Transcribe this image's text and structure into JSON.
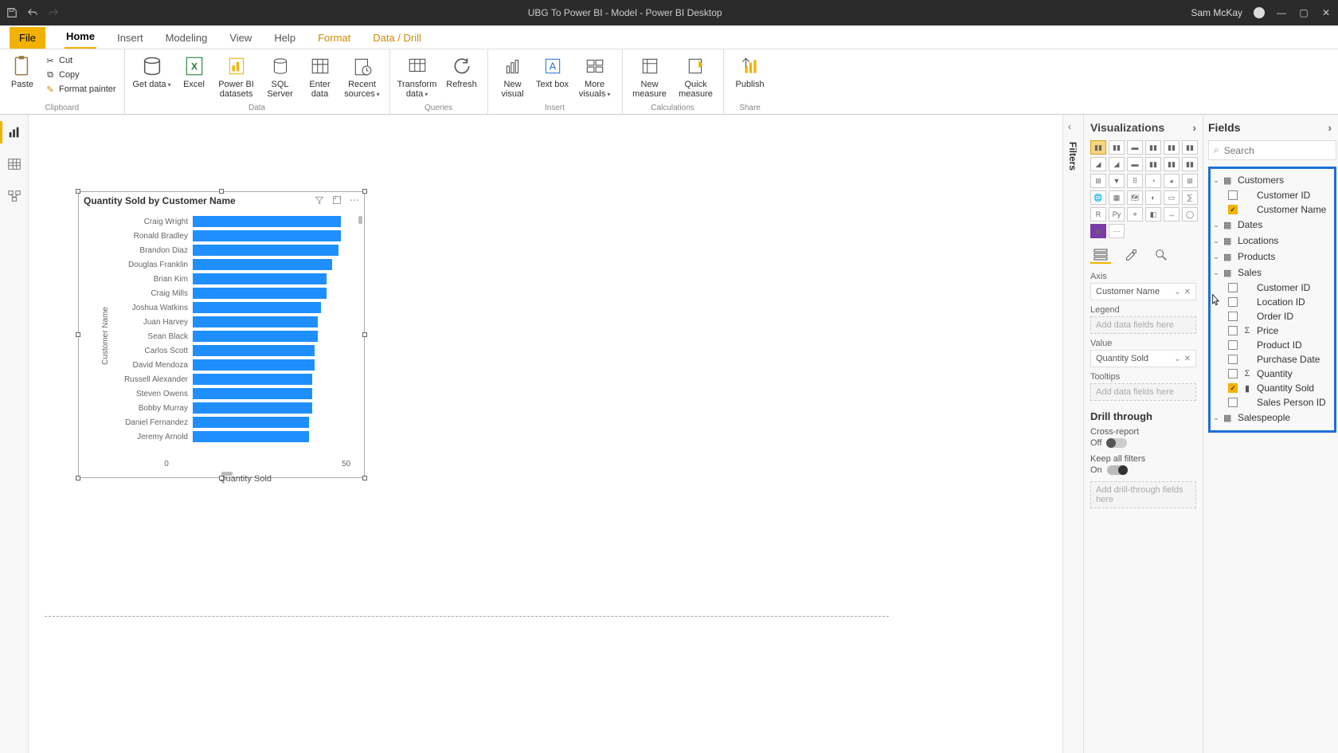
{
  "title_bar": {
    "title": "UBG To Power BI - Model - Power BI Desktop",
    "user": "Sam McKay"
  },
  "ribbon": {
    "tabs": [
      "File",
      "Home",
      "Insert",
      "Modeling",
      "View",
      "Help",
      "Format",
      "Data / Drill"
    ],
    "clipboard": {
      "label": "Clipboard",
      "paste": "Paste",
      "cut": "Cut",
      "copy": "Copy",
      "format_painter": "Format painter"
    },
    "data": {
      "label": "Data",
      "get_data": "Get data",
      "pbi_datasets": "Power BI datasets",
      "sql": "SQL Server",
      "excel": "Excel",
      "enter": "Enter data",
      "recent": "Recent sources"
    },
    "queries": {
      "label": "Queries",
      "transform": "Transform data",
      "refresh": "Refresh"
    },
    "insert": {
      "label": "Insert",
      "new_visual": "New visual",
      "text_box": "Text box",
      "more": "More visuals"
    },
    "calculations": {
      "label": "Calculations",
      "new_measure": "New measure",
      "quick": "Quick measure"
    },
    "share": {
      "label": "Share",
      "publish": "Publish"
    }
  },
  "visual": {
    "title": "Quantity Sold by Customer Name",
    "y_title": "Customer Name",
    "x_title": "Quantity Sold",
    "x_ticks": {
      "t0": "0",
      "t50": "50"
    }
  },
  "chart_data": {
    "type": "bar",
    "orientation": "horizontal",
    "title": "Quantity Sold by Customer Name",
    "xlabel": "Quantity Sold",
    "ylabel": "Customer Name",
    "xlim": [
      0,
      55
    ],
    "categories": [
      "Craig Wright",
      "Ronald Bradley",
      "Brandon Diaz",
      "Douglas Franklin",
      "Brian Kim",
      "Craig Mills",
      "Joshua Watkins",
      "Juan Harvey",
      "Sean Black",
      "Carlos Scott",
      "David Mendoza",
      "Russell Alexander",
      "Steven Owens",
      "Bobby Murray",
      "Daniel Fernandez",
      "Jeremy Arnold"
    ],
    "values": [
      51,
      51,
      50,
      48,
      46,
      46,
      44,
      43,
      43,
      42,
      42,
      41,
      41,
      41,
      40,
      40
    ]
  },
  "filters_pane": {
    "title": "Filters"
  },
  "viz_pane": {
    "title": "Visualizations",
    "wells": {
      "axis_label": "Axis",
      "axis_value": "Customer Name",
      "legend_label": "Legend",
      "legend_placeholder": "Add data fields here",
      "value_label": "Value",
      "value_value": "Quantity Sold",
      "tooltips_label": "Tooltips",
      "tooltips_placeholder": "Add data fields here"
    },
    "drill": {
      "title": "Drill through",
      "cross_report": "Cross-report",
      "cross_report_state": "Off",
      "keep_filters": "Keep all filters",
      "keep_filters_state": "On",
      "placeholder": "Add drill-through fields here"
    }
  },
  "fields_pane": {
    "title": "Fields",
    "search_placeholder": "Search",
    "tables": {
      "customers": {
        "name": "Customers",
        "fields": {
          "customer_id": "Customer ID",
          "customer_name": "Customer Name"
        }
      },
      "dates": "Dates",
      "locations": "Locations",
      "products": "Products",
      "sales": {
        "name": "Sales",
        "fields": {
          "customer_id": "Customer ID",
          "location_id": "Location ID",
          "order_id": "Order ID",
          "price": "Price",
          "product_id": "Product ID",
          "purchase_date": "Purchase Date",
          "quantity": "Quantity",
          "quantity_sold": "Quantity Sold",
          "sales_person_id": "Sales Person ID"
        }
      },
      "salespeople": "Salespeople"
    }
  }
}
